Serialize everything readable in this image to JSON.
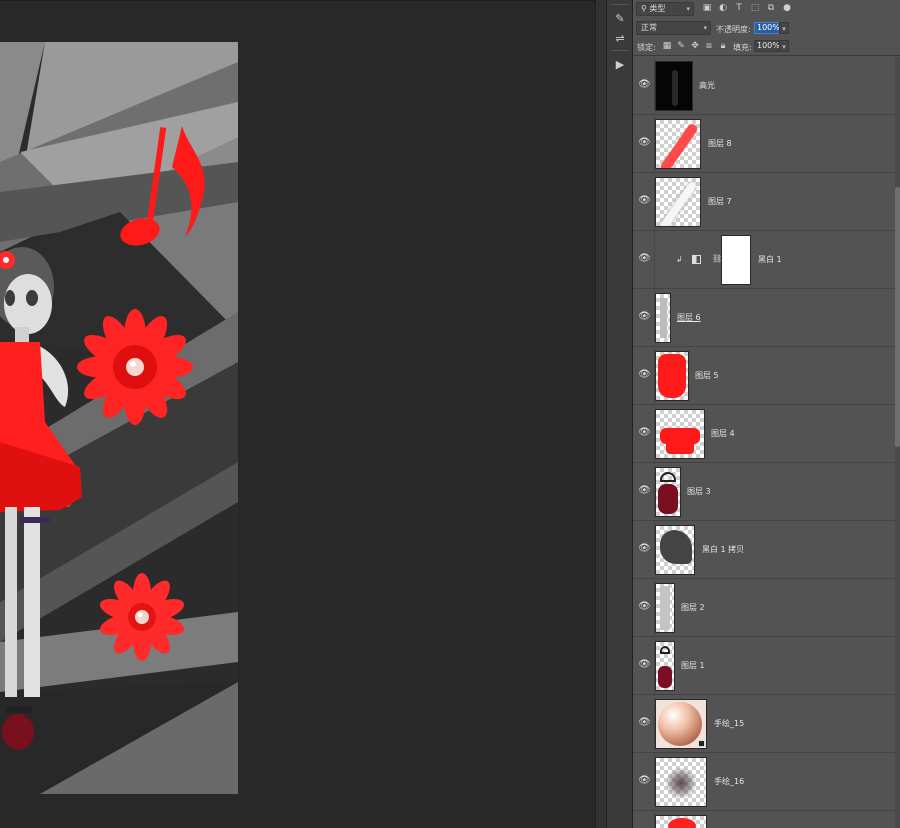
{
  "header": {
    "filter_kind": {
      "icon": "search-icon",
      "label": "类型"
    },
    "filter_icons": [
      "image-filter-icon",
      "adjustment-filter-icon",
      "type-filter-icon",
      "shape-filter-icon",
      "smart-object-filter-icon",
      "toggle-filter-icon"
    ],
    "blend_mode": "正常",
    "opacity_label": "不透明度:",
    "opacity_value": "100%",
    "lock_label": "锁定:",
    "lock_icons": [
      "lock-transparent-icon",
      "lock-image-icon",
      "lock-position-icon",
      "lock-artboard-icon",
      "lock-all-icon"
    ],
    "fill_label": "填充:",
    "fill_value": "100%"
  },
  "tool_column": {
    "icons": [
      "history-icon",
      "brush-settings-icon",
      "adjustments-icon",
      "play-action-icon"
    ]
  },
  "layers": [
    {
      "name": "高光",
      "visible": true,
      "thumbnail": "black-figure"
    },
    {
      "name": "图层 8",
      "visible": true,
      "thumbnail": "red-stroke"
    },
    {
      "name": "图层 7",
      "visible": true,
      "thumbnail": "white-stroke"
    },
    {
      "name": "黑白 1",
      "visible": true,
      "thumbnail": "white-mask",
      "clipped": true,
      "adjustment": true
    },
    {
      "name": "图层 6",
      "visible": true,
      "thumbnail": "figure-legs",
      "underline": true
    },
    {
      "name": "图层 5",
      "visible": true,
      "thumbnail": "red-dress"
    },
    {
      "name": "图层 4",
      "visible": true,
      "thumbnail": "red-ruffle"
    },
    {
      "name": "图层 3",
      "visible": true,
      "thumbnail": "dark-shoe"
    },
    {
      "name": "黑白 1 拷贝",
      "visible": true,
      "thumbnail": "dark-hair"
    },
    {
      "name": "图层 2",
      "visible": true,
      "thumbnail": "grey-legs"
    },
    {
      "name": "图层 1",
      "visible": true,
      "thumbnail": "shoes"
    },
    {
      "name": "手绘_15",
      "visible": true,
      "thumbnail": "pearl",
      "smart_object": true
    },
    {
      "name": "手绘_16",
      "visible": true,
      "thumbnail": "shadow-blur"
    },
    {
      "name": "",
      "visible": true,
      "thumbnail": "red-flower"
    }
  ],
  "colors": {
    "accent_red": "#ff1a1a",
    "panel_bg": "#535353",
    "workspace_bg": "#282828",
    "selection_blue": "#2c5d9f"
  }
}
